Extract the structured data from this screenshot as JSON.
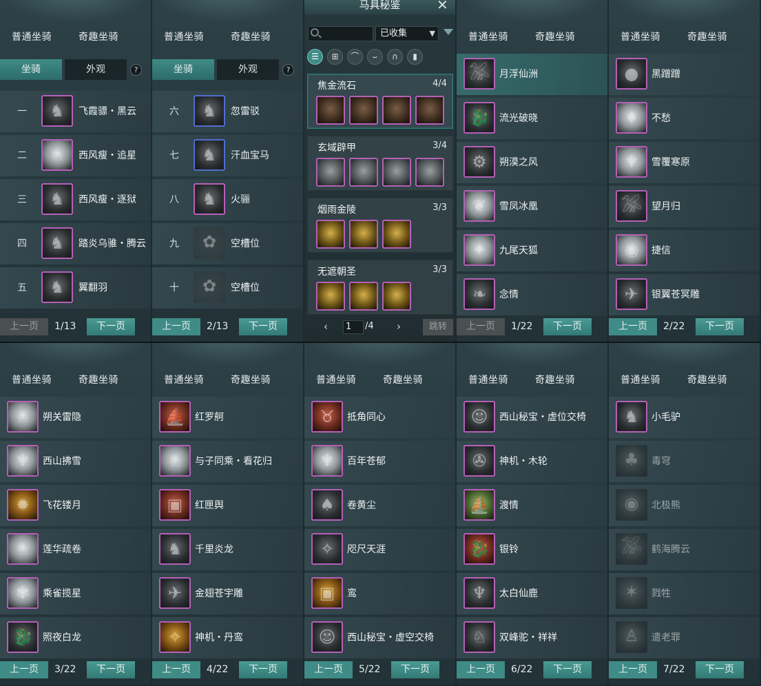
{
  "tabs": {
    "normal": "普通坐骑",
    "fun": "奇趣坐骑"
  },
  "subtabs": {
    "mount": "坐骑",
    "look": "外观",
    "help": "?"
  },
  "pager": {
    "prev": "上一页",
    "next": "下一页"
  },
  "panels": [
    {
      "page": "1/13",
      "has_subtabs": true,
      "prev_enabled": false,
      "rows": [
        {
          "num": "一",
          "name": "飞霞骠・黑云",
          "icon": "horse-black"
        },
        {
          "num": "二",
          "name": "西风瘦・追星",
          "icon": "horse-white"
        },
        {
          "num": "三",
          "name": "西风瘦・逐狱",
          "icon": "horse-black"
        },
        {
          "num": "四",
          "name": "踏炎乌骓・腾云",
          "icon": "horse-black"
        },
        {
          "num": "五",
          "name": "翼翻羽",
          "icon": "horse-black"
        }
      ]
    },
    {
      "page": "2/13",
      "has_subtabs": true,
      "prev_enabled": true,
      "rows": [
        {
          "num": "六",
          "name": "忽雷驳",
          "icon": "horse-black",
          "blue": true
        },
        {
          "num": "七",
          "name": "汗血宝马",
          "icon": "horse-brown",
          "blue": true
        },
        {
          "num": "八",
          "name": "火骊",
          "icon": "horse-brown"
        },
        {
          "num": "九",
          "name": "空槽位",
          "icon": "empty-slot",
          "empty": true
        },
        {
          "num": "十",
          "name": "空槽位",
          "icon": "empty-slot",
          "empty": true
        }
      ]
    },
    {
      "page": "1/22",
      "has_subtabs": false,
      "prev_enabled": false,
      "rows": [
        {
          "name": "月浮仙洲",
          "icon": "crane",
          "hl": true
        },
        {
          "name": "流光破晓",
          "icon": "dragon"
        },
        {
          "name": "朔漠之风",
          "icon": "chariot"
        },
        {
          "name": "雪凤冰凰",
          "icon": "phoenix"
        },
        {
          "name": "九尾天狐",
          "icon": "fox"
        },
        {
          "name": "念情",
          "icon": "branch"
        }
      ]
    },
    {
      "page": "2/22",
      "has_subtabs": false,
      "prev_enabled": true,
      "rows": [
        {
          "name": "黑蹭蹭",
          "icon": "bear-head"
        },
        {
          "name": "不愁",
          "icon": "pelican"
        },
        {
          "name": "雪覆寒原",
          "icon": "deer"
        },
        {
          "name": "望月归",
          "icon": "crane"
        },
        {
          "name": "捷信",
          "icon": "elephant"
        },
        {
          "name": "银翼苍冥雕",
          "icon": "eagle"
        }
      ]
    },
    {
      "page": "3/22",
      "has_subtabs": false,
      "prev_enabled": true,
      "rows": [
        {
          "name": "朔关雷隐",
          "icon": "horse-white"
        },
        {
          "name": "西山拂雪",
          "icon": "deer"
        },
        {
          "name": "飞花镂月",
          "icon": "orb",
          "tone": "gold"
        },
        {
          "name": "莲华疏卷",
          "icon": "horse-white"
        },
        {
          "name": "乘雀揽星",
          "icon": "lotus"
        },
        {
          "name": "照夜白龙",
          "icon": "dragon"
        }
      ]
    },
    {
      "page": "4/22",
      "has_subtabs": false,
      "prev_enabled": true,
      "rows": [
        {
          "name": "红罗舸",
          "icon": "boat",
          "tone": "red"
        },
        {
          "name": "与子同乘・看花归",
          "icon": "horse-white"
        },
        {
          "name": "红匣舆",
          "icon": "sedan",
          "tone": "red"
        },
        {
          "name": "千里炎龙",
          "icon": "horse-black"
        },
        {
          "name": "金翅苍宇雕",
          "icon": "eagle"
        },
        {
          "name": "神机・丹鸾",
          "icon": "bird",
          "tone": "gold"
        }
      ]
    },
    {
      "page": "5/22",
      "has_subtabs": false,
      "prev_enabled": true,
      "rows": [
        {
          "name": "抵角同心",
          "icon": "ox",
          "tone": "red"
        },
        {
          "name": "百年苍郁",
          "icon": "deer",
          "tone": "gold"
        },
        {
          "name": "卷黄尘",
          "icon": "ostrich"
        },
        {
          "name": "咫尺天涯",
          "icon": "bird"
        },
        {
          "name": "鸾",
          "icon": "sedan",
          "tone": "gold"
        },
        {
          "name": "西山秘宝・虚空交椅",
          "icon": "person"
        }
      ]
    },
    {
      "page": "6/22",
      "has_subtabs": false,
      "prev_enabled": true,
      "rows": [
        {
          "name": "西山秘宝・虚位交椅",
          "icon": "person"
        },
        {
          "name": "神机・木轮",
          "icon": "wheel"
        },
        {
          "name": "渡情",
          "icon": "boat",
          "tone": "green"
        },
        {
          "name": "银铃",
          "icon": "dragon",
          "tone": "red"
        },
        {
          "name": "太白仙鹿",
          "icon": "antler"
        },
        {
          "name": "双峰驼・祥祥",
          "icon": "camel"
        }
      ]
    },
    {
      "page": "7/22",
      "has_subtabs": false,
      "prev_enabled": true,
      "rows": [
        {
          "name": "小毛驴",
          "icon": "donkey"
        },
        {
          "name": "毒穹",
          "icon": "tree",
          "dim": true
        },
        {
          "name": "北极熊",
          "icon": "bear",
          "dim": true
        },
        {
          "name": "鹤海腾云",
          "icon": "crane",
          "dim": true
        },
        {
          "name": "戮牲",
          "icon": "beast",
          "dim": true
        },
        {
          "name": "遣老罪",
          "icon": "figure",
          "dim": true
        }
      ]
    }
  ],
  "codex": {
    "title": "马具秘鉴",
    "search_placeholder": "",
    "filter_value": "已收集",
    "page_input": "1",
    "page_total": "/4",
    "jump_label": "跳转",
    "categories": [
      "list-icon",
      "grid-icon",
      "saddle-icon",
      "stirrup-icon",
      "horseshoe-icon",
      "armor-icon"
    ],
    "groups": [
      {
        "name": "焦金流石",
        "count": "4/4",
        "tone": "brown"
      },
      {
        "name": "玄域辟甲",
        "count": "3/4",
        "tone": "grey"
      },
      {
        "name": "烟雨金陵",
        "count": "3/3",
        "tone": "gold"
      },
      {
        "name": "无遮朝圣",
        "count": "3/3",
        "tone": "gold"
      }
    ]
  }
}
